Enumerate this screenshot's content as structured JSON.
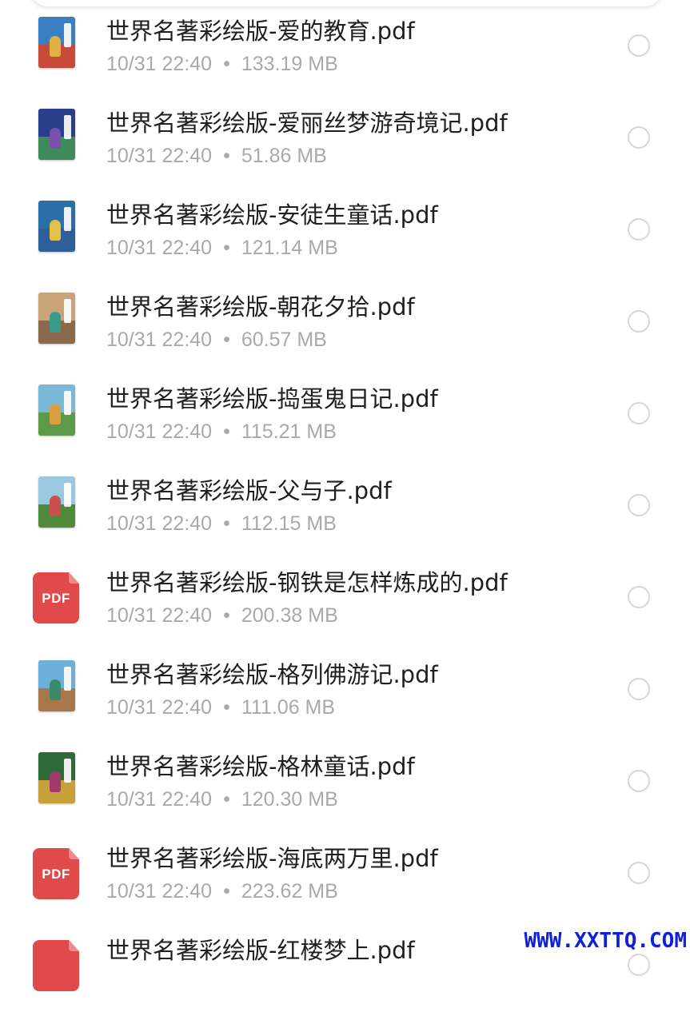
{
  "files": [
    {
      "name": "世界名著彩绘版-爱的教育.pdf",
      "date": "10/31 22:40",
      "size": "133.19 MB",
      "icon": "book-cover-thumbnail",
      "colors": [
        "#3a7fc2",
        "#c84b3a",
        "#e0b040"
      ]
    },
    {
      "name": "世界名著彩绘版-爱丽丝梦游奇境记.pdf",
      "date": "10/31 22:40",
      "size": "51.86 MB",
      "icon": "book-cover-thumbnail",
      "colors": [
        "#2b3e8c",
        "#3f8a5a",
        "#7a4fb0"
      ]
    },
    {
      "name": "世界名著彩绘版-安徒生童话.pdf",
      "date": "10/31 22:40",
      "size": "121.14 MB",
      "icon": "book-cover-thumbnail",
      "colors": [
        "#2a6fa8",
        "#2f5f9a",
        "#e2c04a"
      ]
    },
    {
      "name": "世界名著彩绘版-朝花夕拾.pdf",
      "date": "10/31 22:40",
      "size": "60.57 MB",
      "icon": "book-cover-thumbnail",
      "colors": [
        "#c9a37a",
        "#8a6a4a",
        "#3a9a8a"
      ]
    },
    {
      "name": "世界名著彩绘版-捣蛋鬼日记.pdf",
      "date": "10/31 22:40",
      "size": "115.21 MB",
      "icon": "book-cover-thumbnail",
      "colors": [
        "#7ab8d8",
        "#5c9a4a",
        "#d8a040"
      ]
    },
    {
      "name": "世界名著彩绘版-父与子.pdf",
      "date": "10/31 22:40",
      "size": "112.15 MB",
      "icon": "book-cover-thumbnail",
      "colors": [
        "#9ac8e0",
        "#4f8a3a",
        "#c8504a"
      ]
    },
    {
      "name": "世界名著彩绘版-钢铁是怎样炼成的.pdf",
      "date": "10/31 22:40",
      "size": "200.38 MB",
      "icon": "pdf-icon",
      "label": "PDF"
    },
    {
      "name": "世界名著彩绘版-格列佛游记.pdf",
      "date": "10/31 22:40",
      "size": "111.06 MB",
      "icon": "book-cover-thumbnail",
      "colors": [
        "#6ab0d8",
        "#a8784a",
        "#3a8a6a"
      ]
    },
    {
      "name": "世界名著彩绘版-格林童话.pdf",
      "date": "10/31 22:40",
      "size": "120.30 MB",
      "icon": "book-cover-thumbnail",
      "colors": [
        "#2f6a3a",
        "#c8a03a",
        "#a03a6a"
      ]
    },
    {
      "name": "世界名著彩绘版-海底两万里.pdf",
      "date": "10/31 22:40",
      "size": "223.62 MB",
      "icon": "pdf-icon",
      "label": "PDF"
    },
    {
      "name": "世界名著彩绘版-红楼梦上.pdf",
      "date": "",
      "size": "",
      "icon": "pdf-icon",
      "label": ""
    }
  ],
  "separator": "•",
  "watermark": "WWW.XXTTQ.COM",
  "colors": {
    "name_text": "#1f1f1f",
    "meta_text": "#a9a9a9",
    "pdf_red": "#e04a4a",
    "watermark_blue": "#1020d8"
  }
}
